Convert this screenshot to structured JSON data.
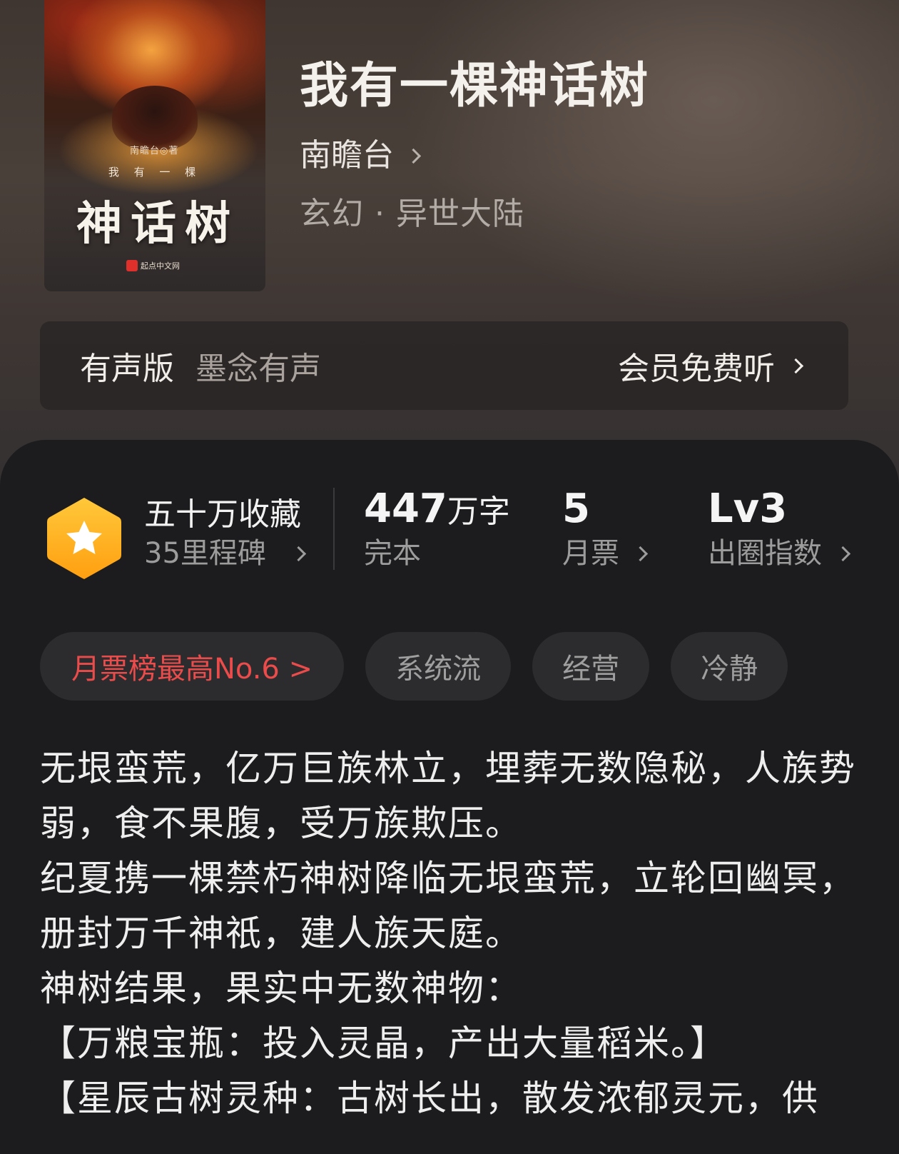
{
  "book": {
    "title": "我有一棵神话树",
    "author": "南瞻台",
    "genre": "玄幻 · 异世大陆",
    "cover": {
      "author_line": "南瞻台◎著",
      "subtitle": "我 有 一 棵",
      "title": "神话树",
      "publisher": "起点中文网"
    }
  },
  "audio": {
    "label": "有声版",
    "source": "墨念有声",
    "cta": "会员免费听"
  },
  "stats": {
    "collection": {
      "title": "五十万收藏",
      "sub": "35里程碑"
    },
    "words": {
      "value": "447",
      "unit": "万字",
      "sub": "完本"
    },
    "monthly_ticket": {
      "value": "5",
      "sub": "月票"
    },
    "level": {
      "value": "Lv3",
      "sub": "出圈指数"
    }
  },
  "tags": [
    "月票榜最高No.6 >",
    "系统流",
    "经营",
    "冷静"
  ],
  "description": [
    "无垠蛮荒，亿万巨族林立，埋葬无数隐秘，人族势弱，食不果腹，受万族欺压。",
    "纪夏携一棵禁朽神树降临无垠蛮荒，立轮回幽冥，册封万千神祇，建人族天庭。",
    "神树结果，果实中无数神物：",
    "【万粮宝瓶：投入灵晶，产出大量稻米。】",
    "【星辰古树灵种：古树长出，散发浓郁灵元，供"
  ],
  "colors": {
    "background": "#1c1c1e",
    "accent_red": "#ea4b4b",
    "badge_orange": "#ffb21f"
  },
  "icons": {
    "badge": "star-hexagon-icon",
    "chevron": "chevron-right-icon"
  }
}
